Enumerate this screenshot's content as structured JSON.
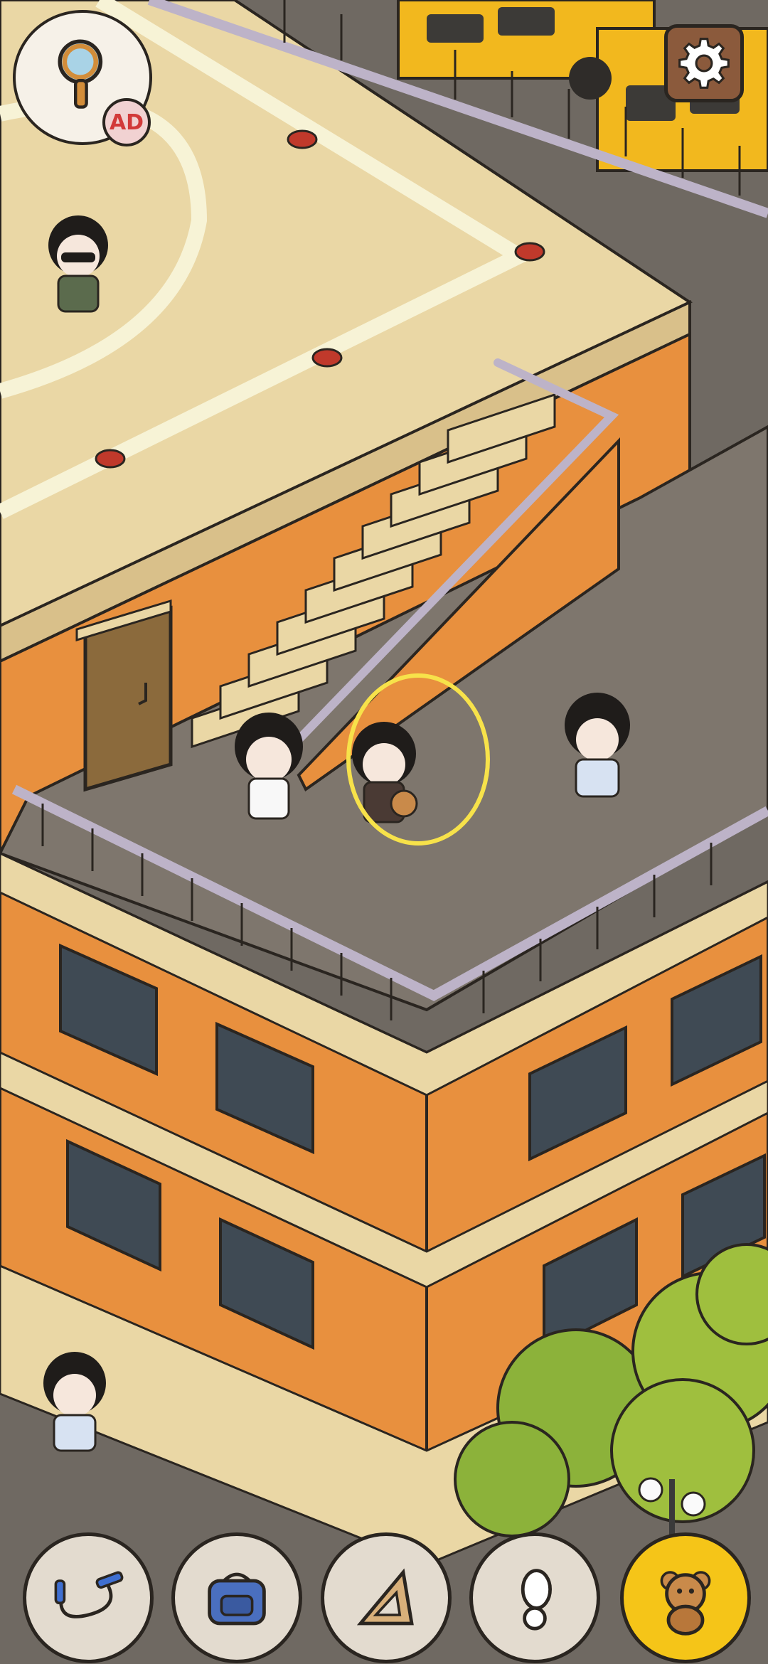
{
  "hud": {
    "hint_badge": "AD",
    "hint_icon": "magnifier-icon",
    "settings_icon": "gear-icon"
  },
  "highlight": {
    "color": "#f7e24a"
  },
  "colors": {
    "wall_orange": "#e8903e",
    "roof_beige": "#ead7a5",
    "roof_floor_grey": "#7e766d",
    "railing": "#bdb3c8",
    "tray_found": "#f5c518",
    "tray_default": "#e3dbcf"
  },
  "tray": {
    "items": [
      {
        "icon": "jump-rope-icon",
        "found": false
      },
      {
        "icon": "backpack-icon",
        "found": false
      },
      {
        "icon": "triangle-ruler-icon",
        "found": false
      },
      {
        "icon": "shoe-print-icon",
        "found": false
      },
      {
        "icon": "teddy-bear-icon",
        "found": true
      }
    ]
  }
}
